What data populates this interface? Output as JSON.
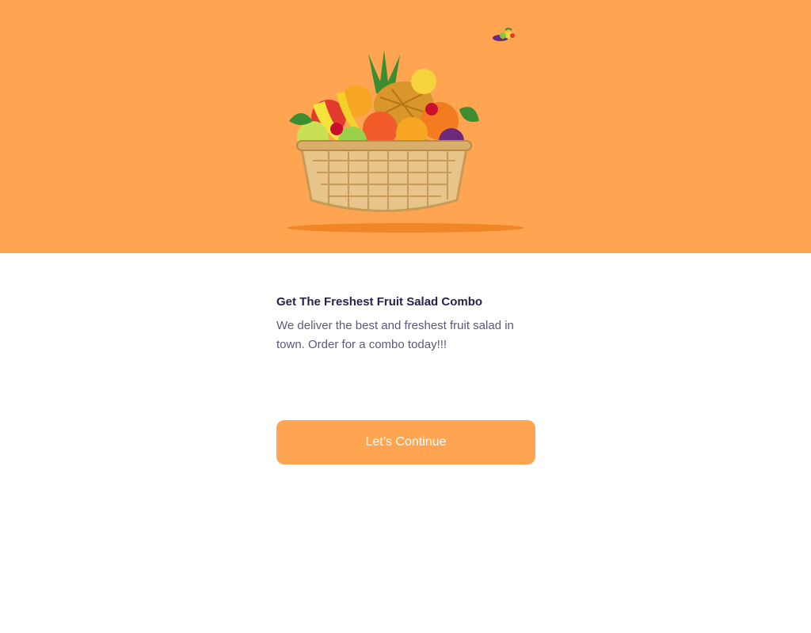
{
  "onboarding": {
    "hero": {
      "illustration": "fruit-basket-illustration",
      "accent_icon": "fruit-cluster-icon",
      "background_color": "#FFA451"
    },
    "title": "Get The Freshest Fruit Salad Combo",
    "description": "We deliver the best and freshest fruit salad in town. Order for a combo today!!!",
    "continue_label": "Let’s Continue",
    "colors": {
      "primary": "#FFA451",
      "title_text": "#27214D",
      "body_text": "#5D577E"
    }
  }
}
